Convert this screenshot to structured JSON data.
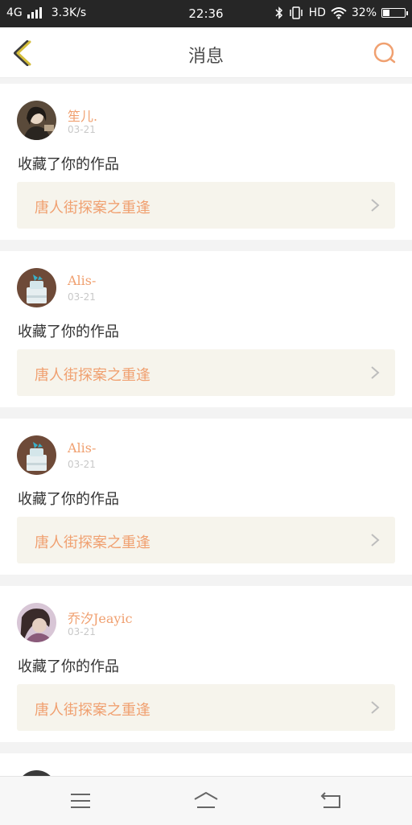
{
  "status_bar": {
    "network": "4G",
    "speed": "3.3K/s",
    "time": "22:36",
    "hd": "HD",
    "battery": "32%",
    "battery_level": 0.32,
    "icons": [
      "signal-icon",
      "bluetooth-icon",
      "vibrate-icon",
      "wifi-icon",
      "battery-icon"
    ]
  },
  "header": {
    "title": "消息",
    "back_icon": "chevron-left-icon",
    "search_icon": "search-icon",
    "accent": "#f0a070",
    "back_color": "#c9b23a"
  },
  "messages": [
    {
      "user": "笙儿.",
      "date": "03-21",
      "action": "收藏了你的作品",
      "work": "唐人街探案之重逢",
      "avatar": "avatar-photo-1"
    },
    {
      "user": "Alis-",
      "date": "03-21",
      "action": "收藏了你的作品",
      "work": "唐人街探案之重逢",
      "avatar": "avatar-cake-1"
    },
    {
      "user": "Alis-",
      "date": "03-21",
      "action": "收藏了你的作品",
      "work": "唐人街探案之重逢",
      "avatar": "avatar-cake-2"
    },
    {
      "user": "乔汐Jeayic",
      "date": "03-21",
      "action": "收藏了你的作品",
      "work": "唐人街探案之重逢",
      "avatar": "avatar-photo-2"
    }
  ],
  "nav": {
    "icons": [
      "menu-icon",
      "home-icon",
      "back-icon"
    ]
  }
}
